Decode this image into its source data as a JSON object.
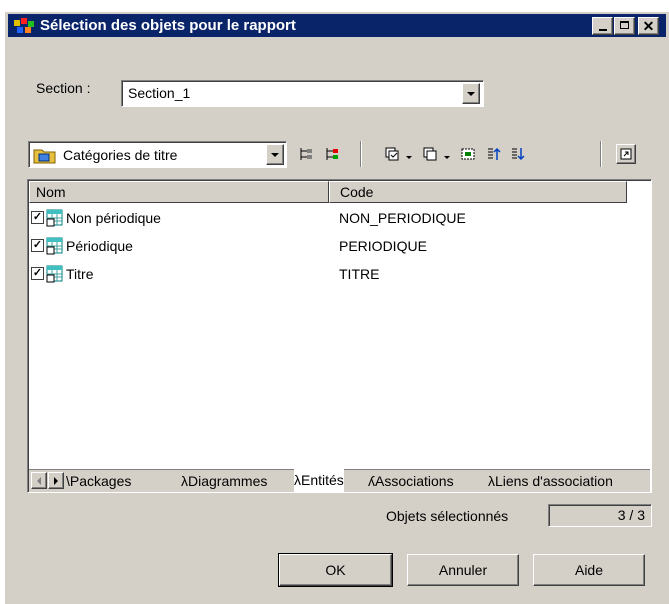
{
  "window": {
    "title": "Sélection des objets pour le rapport"
  },
  "section": {
    "label": "Section :",
    "value": "Section_1"
  },
  "category_combo": {
    "value": "Catégories de titre"
  },
  "list": {
    "columns": [
      "Nom",
      "Code"
    ],
    "rows": [
      {
        "name": "Non périodique",
        "code": "NON_PERIODIQUE",
        "checked": true
      },
      {
        "name": "Périodique",
        "code": "PERIODIQUE",
        "checked": true
      },
      {
        "name": "Titre",
        "code": "TITRE",
        "checked": true
      }
    ]
  },
  "tabs": [
    "Packages",
    "Diagrammes",
    "Entités",
    "Associations",
    "Liens d'association"
  ],
  "active_tab": "Entités",
  "status": {
    "label": "Objets sélectionnés",
    "value": "3 / 3"
  },
  "buttons": {
    "ok": "OK",
    "cancel": "Annuler",
    "help": "Aide"
  },
  "colors": {
    "titlebar": "#0a246a",
    "face": "#d4d0c8"
  }
}
